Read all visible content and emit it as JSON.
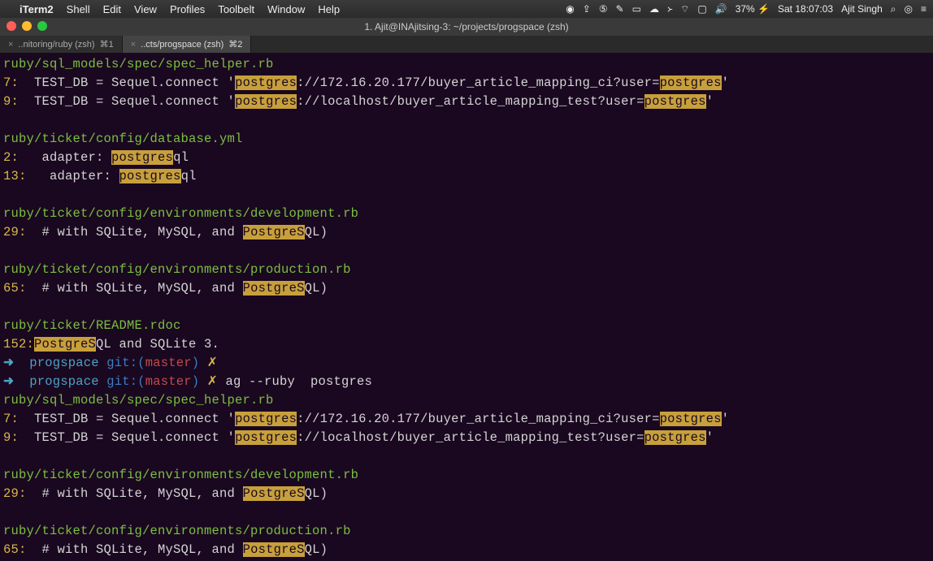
{
  "menubar": {
    "apple": "",
    "app": "iTerm2",
    "items": [
      "Shell",
      "Edit",
      "View",
      "Profiles",
      "Toolbelt",
      "Window",
      "Help"
    ],
    "battery": "37%",
    "clock": "Sat 18:07:03",
    "user": "Ajit Singh"
  },
  "window": {
    "title": "1. Ajit@INAjitsing-3: ~/projects/progspace (zsh)"
  },
  "tabs": [
    {
      "label": "..nitoring/ruby (zsh)",
      "shortcut": "⌘1",
      "active": false
    },
    {
      "label": "..cts/progspace (zsh)",
      "shortcut": "⌘2",
      "active": true
    }
  ],
  "blocks": [
    {
      "file": "ruby/sql_models/spec/spec_helper.rb",
      "lines": [
        {
          "num": "7:",
          "pre": "  TEST_DB = Sequel.connect '",
          "hl1": "postgres",
          "mid1": "://172.16.20.177/buyer_article_mapping_ci?user=",
          "hl2": "postgres",
          "post": "'"
        },
        {
          "num": "9:",
          "pre": "  TEST_DB = Sequel.connect '",
          "hl1": "postgres",
          "mid1": "://localhost/buyer_article_mapping_test?user=",
          "hl2": "postgres",
          "post": "'"
        }
      ]
    },
    {
      "file": "ruby/ticket/config/database.yml",
      "lines": [
        {
          "num": "2:",
          "pre": "   adapter: ",
          "hl1": "postgres",
          "post": "ql"
        },
        {
          "num": "13:",
          "pre": "   adapter: ",
          "hl1": "postgres",
          "post": "ql"
        }
      ]
    },
    {
      "file": "ruby/ticket/config/environments/development.rb",
      "lines": [
        {
          "num": "29:",
          "pre": "  # with SQLite, MySQL, and ",
          "hl1": "PostgreS",
          "post": "QL)"
        }
      ]
    },
    {
      "file": "ruby/ticket/config/environments/production.rb",
      "lines": [
        {
          "num": "65:",
          "pre": "  # with SQLite, MySQL, and ",
          "hl1": "PostgreS",
          "post": "QL)"
        }
      ]
    },
    {
      "file": "ruby/ticket/README.rdoc",
      "lines": [
        {
          "num": "152:",
          "pre": "",
          "hl1": "PostgreS",
          "post": "QL and SQLite 3."
        }
      ]
    }
  ],
  "prompts": [
    {
      "arrow": "➜",
      "dir": "progspace",
      "git1": "git:(",
      "branch": "master",
      "git2": ")",
      "dirty": "✗",
      "cmd": ""
    },
    {
      "arrow": "➜",
      "dir": "progspace",
      "git1": "git:(",
      "branch": "master",
      "git2": ")",
      "dirty": "✗",
      "cmd": "ag --ruby  postgres"
    }
  ],
  "blocks2": [
    {
      "file": "ruby/sql_models/spec/spec_helper.rb",
      "lines": [
        {
          "num": "7:",
          "pre": "  TEST_DB = Sequel.connect '",
          "hl1": "postgres",
          "mid1": "://172.16.20.177/buyer_article_mapping_ci?user=",
          "hl2": "postgres",
          "post": "'"
        },
        {
          "num": "9:",
          "pre": "  TEST_DB = Sequel.connect '",
          "hl1": "postgres",
          "mid1": "://localhost/buyer_article_mapping_test?user=",
          "hl2": "postgres",
          "post": "'"
        }
      ]
    },
    {
      "file": "ruby/ticket/config/environments/development.rb",
      "lines": [
        {
          "num": "29:",
          "pre": "  # with SQLite, MySQL, and ",
          "hl1": "PostgreS",
          "post": "QL)"
        }
      ]
    },
    {
      "file": "ruby/ticket/config/environments/production.rb",
      "lines": [
        {
          "num": "65:",
          "pre": "  # with SQLite, MySQL, and ",
          "hl1": "PostgreS",
          "post": "QL)"
        }
      ]
    }
  ]
}
